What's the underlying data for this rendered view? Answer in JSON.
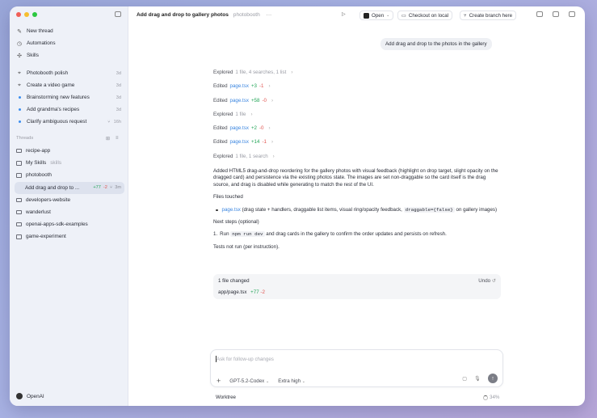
{
  "sidebar": {
    "nav": [
      {
        "label": "New thread",
        "icon": "edit-icon"
      },
      {
        "label": "Automations",
        "icon": "clock-icon"
      },
      {
        "label": "Skills",
        "icon": "skills-icon"
      }
    ],
    "tasks": [
      {
        "label": "Photobooth polish",
        "time": "3d",
        "unread": false
      },
      {
        "label": "Create a video game",
        "time": "3d",
        "unread": false
      },
      {
        "label": "Brainstorming new features",
        "time": "3d",
        "unread": true
      },
      {
        "label": "Add grandma's recipes",
        "time": "3d",
        "unread": true
      },
      {
        "label": "Clarify ambiguous request",
        "time": "16h",
        "unread": true
      }
    ],
    "threads_header": "Threads",
    "threads": [
      {
        "label": "recipe-app"
      },
      {
        "label": "My Skills",
        "tag": "skills"
      },
      {
        "label": "photobooth"
      },
      {
        "label": "Add drag and drop to ...",
        "added": "+77",
        "removed": "-2",
        "time": "3m"
      },
      {
        "label": "developers-website"
      },
      {
        "label": "wanderlust"
      },
      {
        "label": "openai-apps-sdk-examples"
      },
      {
        "label": "game-experiment"
      }
    ],
    "user": "OpenAI"
  },
  "header": {
    "title": "Add drag and drop to gallery photos",
    "project": "photobooth",
    "open_label": "Open",
    "checkout_label": "Checkout on local",
    "branch_label": "Create branch here"
  },
  "conversation": {
    "user_message": "Add drag and drop to the photos in the gallery",
    "steps": [
      {
        "verb": "Explored",
        "detail": "1 file, 4 searches, 1 list"
      },
      {
        "verb": "Edited",
        "file": "page.tsx",
        "added": "+3",
        "removed": "-1"
      },
      {
        "verb": "Edited",
        "file": "page.tsx",
        "added": "+58",
        "removed": "-0"
      },
      {
        "verb": "Explored",
        "detail": "1 file"
      },
      {
        "verb": "Edited",
        "file": "page.tsx",
        "added": "+2",
        "removed": "-0"
      },
      {
        "verb": "Edited",
        "file": "page.tsx",
        "added": "+14",
        "removed": "-1"
      },
      {
        "verb": "Explored",
        "detail": "1 file, 1 search"
      }
    ],
    "summary": "Added HTML5 drag-and-drop reordering for the gallery photos with visual feedback (highlight on drop target, slight opacity on the dragged card) and persistence via the existing photos state. The images are set non-draggable so the card itself is the drag source, and drag is disabled while generating to match the rest of the UI.",
    "files_touched_label": "Files touched",
    "file_bullet": {
      "file": "page.tsx",
      "pre": "(drag state + handlers, draggable list items, visual ring/opacity feedback,",
      "code": "draggable={false}",
      "post": "on gallery images)"
    },
    "next_steps_label": "Next steps (optional)",
    "next_step": {
      "num": "1.",
      "pre": "Run",
      "code": "npm run dev",
      "post": "and drag cards in the gallery to confirm the order updates and persists on refresh."
    },
    "tests_note": "Tests not run (per instruction)."
  },
  "changes": {
    "header": "1 file changed",
    "undo_label": "Undo",
    "file": "app/page.tsx",
    "added": "+77",
    "removed": "-2"
  },
  "composer": {
    "placeholder": "Ask for follow-up changes",
    "model": "GPT-5.2-Codex",
    "effort": "Extra high"
  },
  "footer": {
    "worktree_label": "Worktree",
    "percent": "34%"
  }
}
